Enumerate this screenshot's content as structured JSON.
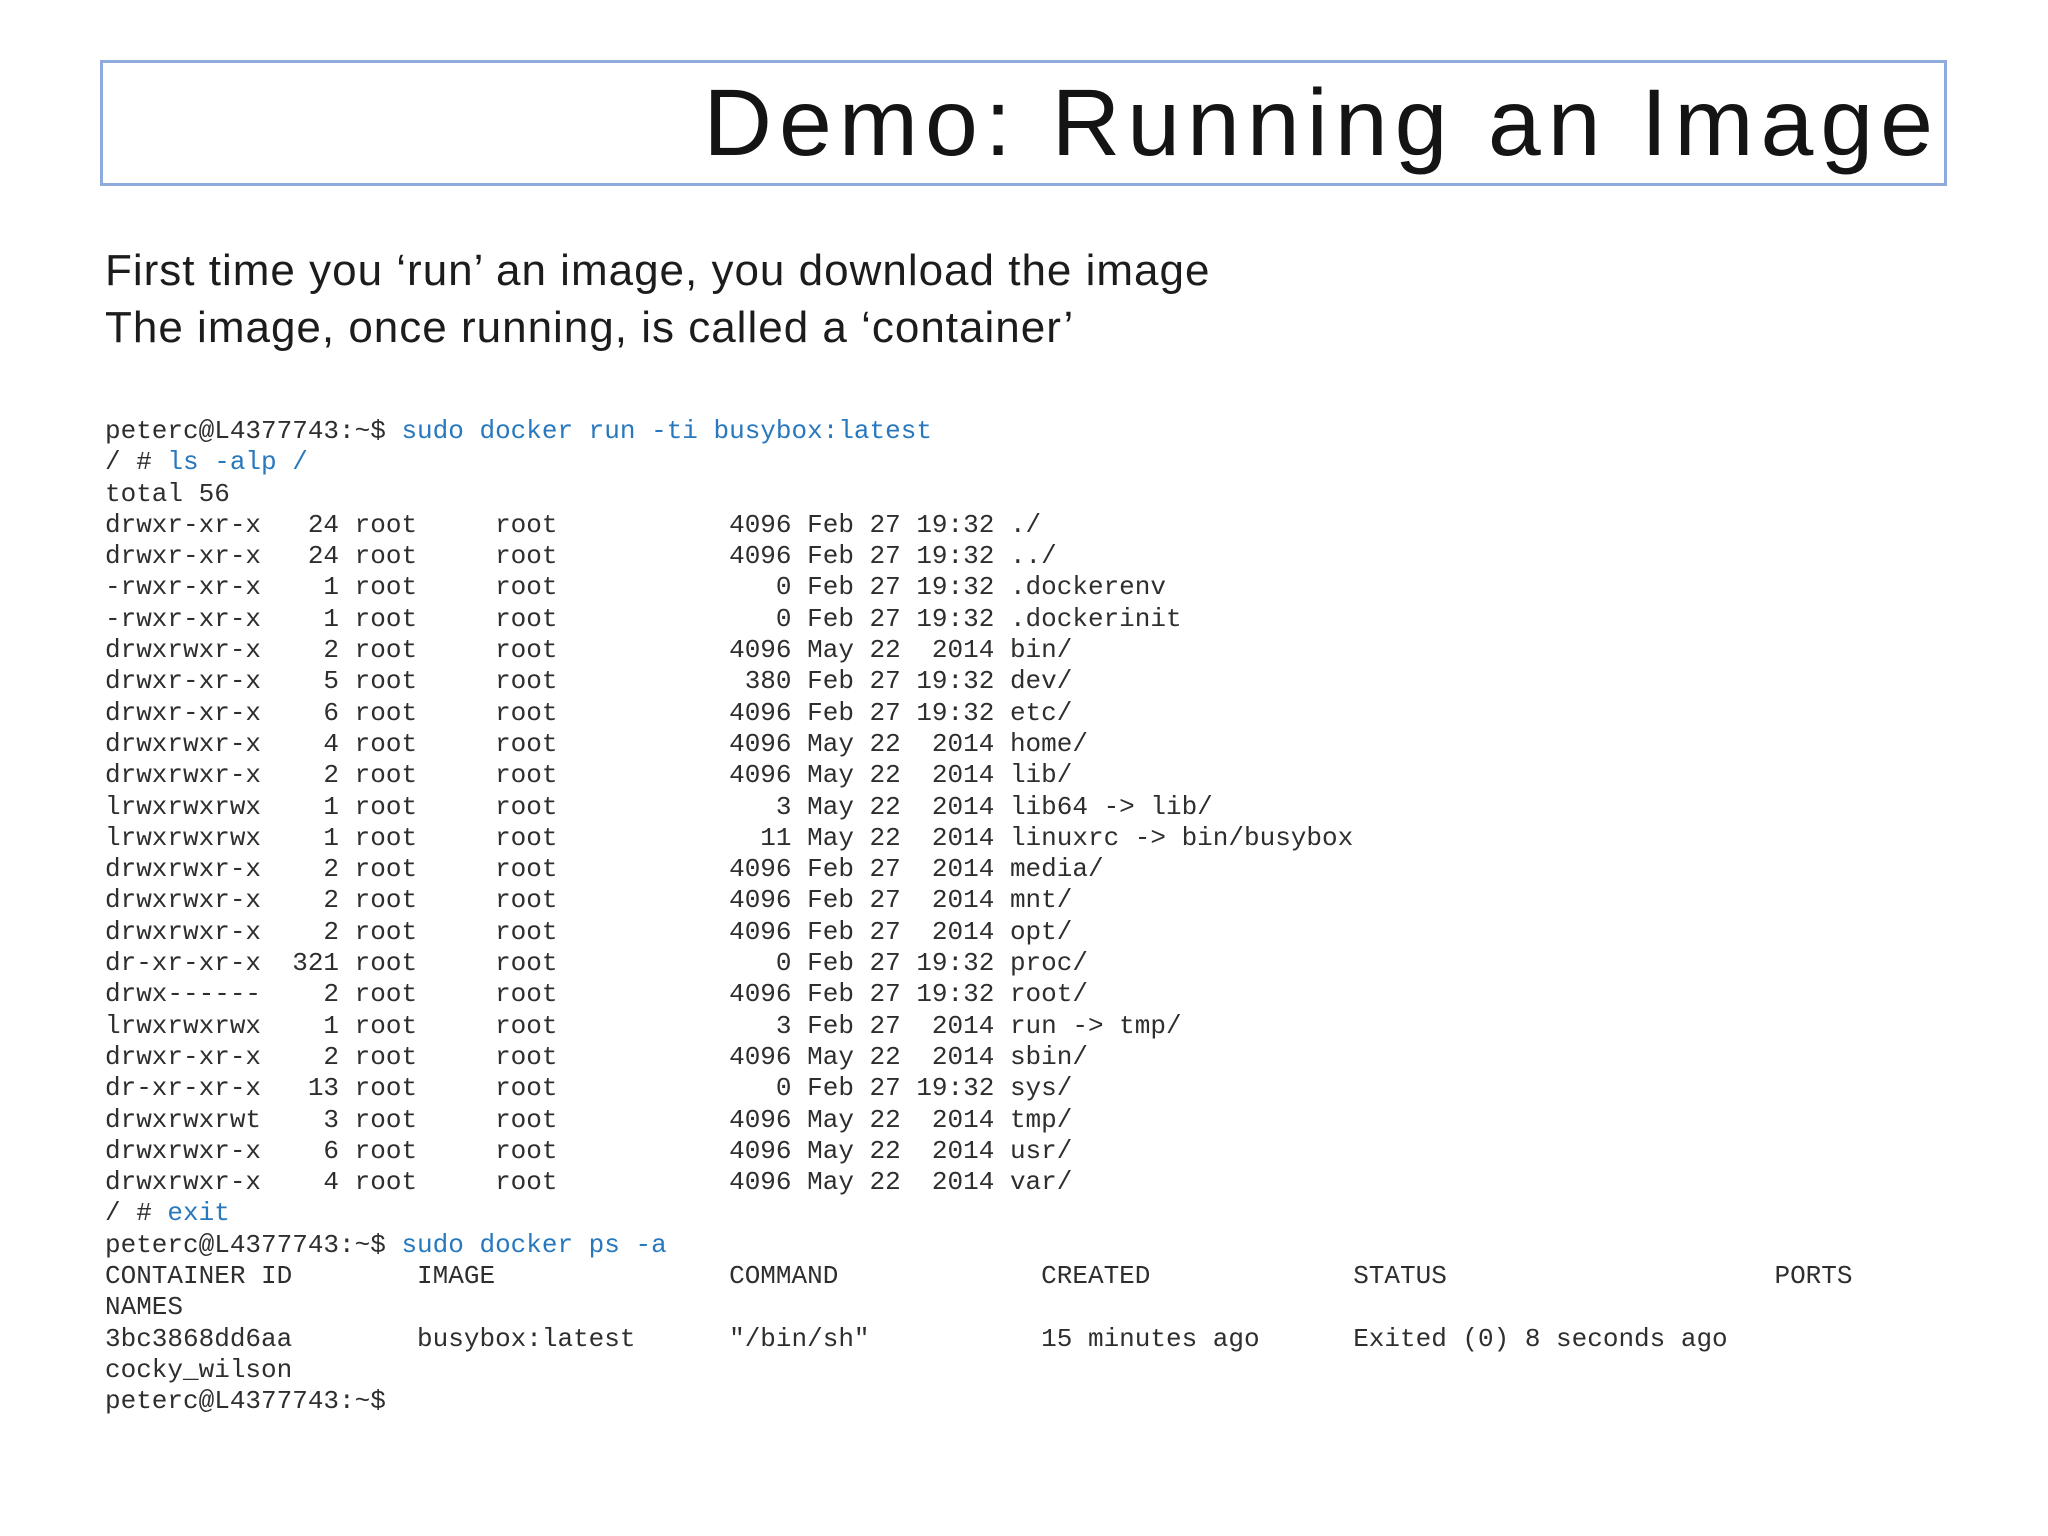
{
  "slide": {
    "title": "Demo: Running an Image"
  },
  "body": {
    "line1": "First time you ‘run’ an image, you download the image",
    "line2": "The image, once running, is called a ‘container’"
  },
  "colors": {
    "title_border": "#8faadc",
    "body_text": "#1c1c1c",
    "terminal_text": "#2e2e2e",
    "command_blue": "#2878be"
  },
  "terminal": {
    "lines": [
      [
        [
          "peterc@L4377743:~$ ",
          "plain"
        ],
        [
          "sudo docker run -ti busybox:latest",
          "cmd"
        ]
      ],
      [
        [
          "/ # ",
          "plain"
        ],
        [
          "ls -alp /",
          "cmd"
        ]
      ],
      [
        [
          "total 56",
          "plain"
        ]
      ],
      [
        [
          "drwxr-xr-x   24 root     root           4096 Feb 27 19:32 ./",
          "plain"
        ]
      ],
      [
        [
          "drwxr-xr-x   24 root     root           4096 Feb 27 19:32 ../",
          "plain"
        ]
      ],
      [
        [
          "-rwxr-xr-x    1 root     root              0 Feb 27 19:32 .dockerenv",
          "plain"
        ]
      ],
      [
        [
          "-rwxr-xr-x    1 root     root              0 Feb 27 19:32 .dockerinit",
          "plain"
        ]
      ],
      [
        [
          "drwxrwxr-x    2 root     root           4096 May 22  2014 bin/",
          "plain"
        ]
      ],
      [
        [
          "drwxr-xr-x    5 root     root            380 Feb 27 19:32 dev/",
          "plain"
        ]
      ],
      [
        [
          "drwxr-xr-x    6 root     root           4096 Feb 27 19:32 etc/",
          "plain"
        ]
      ],
      [
        [
          "drwxrwxr-x    4 root     root           4096 May 22  2014 home/",
          "plain"
        ]
      ],
      [
        [
          "drwxrwxr-x    2 root     root           4096 May 22  2014 lib/",
          "plain"
        ]
      ],
      [
        [
          "lrwxrwxrwx    1 root     root              3 May 22  2014 lib64 -> lib/",
          "plain"
        ]
      ],
      [
        [
          "lrwxrwxrwx    1 root     root             11 May 22  2014 linuxrc -> bin/busybox",
          "plain"
        ]
      ],
      [
        [
          "drwxrwxr-x    2 root     root           4096 Feb 27  2014 media/",
          "plain"
        ]
      ],
      [
        [
          "drwxrwxr-x    2 root     root           4096 Feb 27  2014 mnt/",
          "plain"
        ]
      ],
      [
        [
          "drwxrwxr-x    2 root     root           4096 Feb 27  2014 opt/",
          "plain"
        ]
      ],
      [
        [
          "dr-xr-xr-x  321 root     root              0 Feb 27 19:32 proc/",
          "plain"
        ]
      ],
      [
        [
          "drwx------    2 root     root           4096 Feb 27 19:32 root/",
          "plain"
        ]
      ],
      [
        [
          "lrwxrwxrwx    1 root     root              3 Feb 27  2014 run -> tmp/",
          "plain"
        ]
      ],
      [
        [
          "drwxr-xr-x    2 root     root           4096 May 22  2014 sbin/",
          "plain"
        ]
      ],
      [
        [
          "dr-xr-xr-x   13 root     root              0 Feb 27 19:32 sys/",
          "plain"
        ]
      ],
      [
        [
          "drwxrwxrwt    3 root     root           4096 May 22  2014 tmp/",
          "plain"
        ]
      ],
      [
        [
          "drwxrwxr-x    6 root     root           4096 May 22  2014 usr/",
          "plain"
        ]
      ],
      [
        [
          "drwxrwxr-x    4 root     root           4096 May 22  2014 var/",
          "plain"
        ]
      ],
      [
        [
          "/ # ",
          "plain"
        ],
        [
          "exit",
          "cmd"
        ]
      ],
      [
        [
          "peterc@L4377743:~$ ",
          "plain"
        ],
        [
          "sudo docker ps -a",
          "cmd"
        ]
      ],
      [
        [
          "CONTAINER ID        IMAGE               COMMAND             CREATED             STATUS                     PORTS",
          "plain"
        ]
      ],
      [
        [
          "NAMES",
          "plain"
        ]
      ],
      [
        [
          "3bc3868dd6aa        busybox:latest      \"/bin/sh\"           15 minutes ago      Exited (0) 8 seconds ago",
          "plain"
        ]
      ],
      [
        [
          "cocky_wilson",
          "plain"
        ]
      ],
      [
        [
          "peterc@L4377743:~$",
          "plain"
        ]
      ]
    ]
  }
}
